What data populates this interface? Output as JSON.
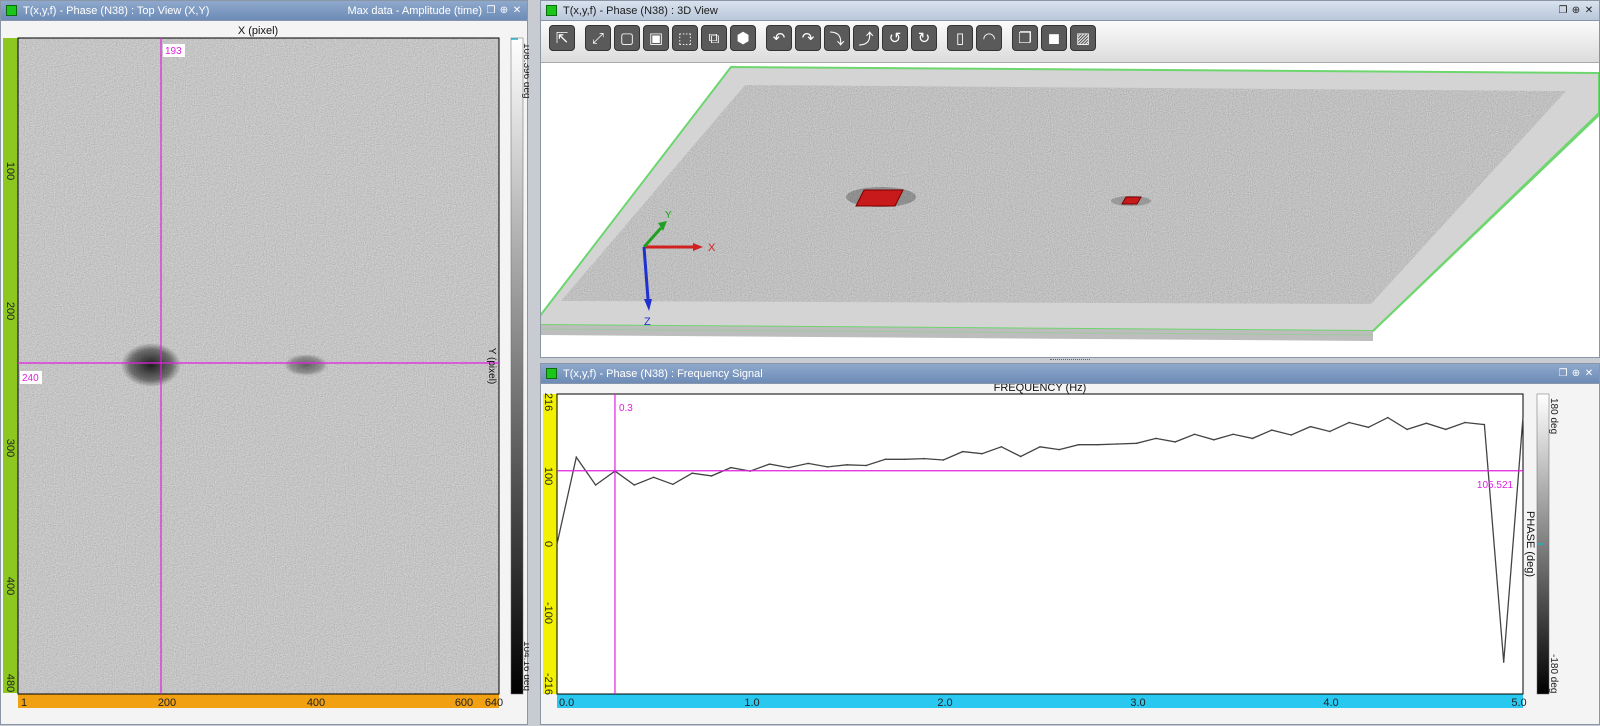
{
  "left_panel": {
    "title": "T(x,y,f) - Phase (N38) : Top View (X,Y)",
    "right_label": "Max data - Amplitude (time)",
    "x_axis_label": "X (pixel)",
    "y_axis_label": "Y (pixel)",
    "x_ticks": [
      "1",
      "200",
      "400",
      "600",
      "640"
    ],
    "y_ticks": [
      "100",
      "200",
      "300",
      "400",
      "480"
    ],
    "cursor_x": "193",
    "cursor_y": "240",
    "colorbar_max": "108.396 deg",
    "colorbar_min": "104.16 deg"
  },
  "view3d_panel": {
    "title": "T(x,y,f) - Phase (N38) : 3D View",
    "axis_x": "X",
    "axis_y": "Y",
    "axis_z": "Z",
    "toolbar_icons": [
      "select-icon",
      "fit-icon",
      "cube-front-icon",
      "cube-red-icon",
      "cube-wire-icon",
      "cube-red-wire-icon",
      "cube-iso-icon",
      "rotate-left-icon",
      "rotate-right-icon",
      "rotate-down-icon",
      "rotate-up-icon",
      "rotate-ccw-icon",
      "rotate-cw-icon",
      "ruler-icon",
      "dome-icon",
      "box-outline-icon",
      "box-solid-icon",
      "hatch-icon"
    ],
    "toolbar_glyphs": [
      "⇱",
      "⤢",
      "▢",
      "▣",
      "⬚",
      "⧉",
      "⬢",
      "↶",
      "↷",
      "⤵",
      "⤴",
      "↺",
      "↻",
      "▯",
      "◠",
      "❐",
      "◼",
      "▨"
    ]
  },
  "freq_panel": {
    "title": "T(x,y,f) - Phase (N38) : Frequency Signal",
    "x_axis_label": "FREQUENCY (Hz)",
    "y_axis_label": "PHASE (deg)",
    "y_ticks": [
      "216",
      "100",
      "0",
      "-100",
      "-216"
    ],
    "x_ticks": [
      "0.0",
      "1.0",
      "2.0",
      "3.0",
      "4.0",
      "5.0"
    ],
    "cursor_x": "0.3",
    "cursor_y": "105.521",
    "colorbar_max": "180 deg",
    "colorbar_min": "-180 deg"
  },
  "chart_data": {
    "type": "line",
    "xlabel": "FREQUENCY (Hz)",
    "ylabel": "PHASE (deg)",
    "xlim": [
      0,
      5
    ],
    "ylim": [
      -216,
      216
    ],
    "x": [
      0.0,
      0.1,
      0.2,
      0.3,
      0.4,
      0.5,
      0.6,
      0.7,
      0.8,
      0.9,
      1.0,
      1.1,
      1.2,
      1.3,
      1.4,
      1.5,
      1.6,
      1.7,
      1.8,
      1.9,
      2.0,
      2.1,
      2.2,
      2.3,
      2.4,
      2.5,
      2.6,
      2.7,
      2.8,
      2.9,
      3.0,
      3.1,
      3.2,
      3.3,
      3.4,
      3.5,
      3.6,
      3.7,
      3.8,
      3.9,
      4.0,
      4.1,
      4.2,
      4.3,
      4.4,
      4.5,
      4.6,
      4.7,
      4.8,
      4.9,
      5.0
    ],
    "y": [
      0,
      125,
      85,
      105,
      85,
      96,
      86,
      102,
      98,
      110,
      105,
      115,
      110,
      116,
      111,
      114,
      113,
      122,
      122,
      123,
      121,
      133,
      130,
      140,
      126,
      140,
      136,
      143,
      143,
      144,
      145,
      152,
      147,
      158,
      150,
      158,
      152,
      164,
      157,
      169,
      162,
      175,
      168,
      182,
      165,
      174,
      165,
      175,
      172,
      -170,
      183
    ]
  }
}
